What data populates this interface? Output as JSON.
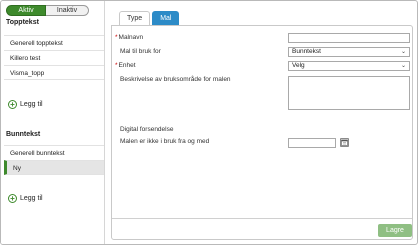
{
  "filter": {
    "active_label": "Aktiv",
    "inactive_label": "Inaktiv"
  },
  "sidebar": {
    "sections": [
      {
        "title": "Topptekst",
        "items": [
          {
            "label": "Generell topptekst"
          },
          {
            "label": "Killero test"
          },
          {
            "label": "Visma_topp"
          }
        ],
        "add_label": "Legg til"
      },
      {
        "title": "Bunntekst",
        "items": [
          {
            "label": "Generell bunntekst"
          },
          {
            "label": "Ny",
            "selected": true
          }
        ],
        "add_label": "Legg til"
      }
    ]
  },
  "tabs": [
    {
      "label": "Type",
      "active": false
    },
    {
      "label": "Mal",
      "active": true
    }
  ],
  "form": {
    "name_label": "Malnavn",
    "name_value": "",
    "usage_label": "Mal til bruk for",
    "usage_value": "Bunntekst",
    "unit_label": "Enhet",
    "unit_value": "Velg",
    "description_label": "Beskrivelse av bruksområde for malen",
    "digital_label": "Digital forsendelse",
    "not_in_use_label": "Malen er ikke i bruk fra og med",
    "date_value": ""
  },
  "actions": {
    "save_label": "Lagre"
  },
  "colors": {
    "accent_green": "#3e8a2c",
    "tab_blue": "#2d8bc7",
    "save_disabled": "#8fbf83",
    "required_red": "#cc0000"
  }
}
